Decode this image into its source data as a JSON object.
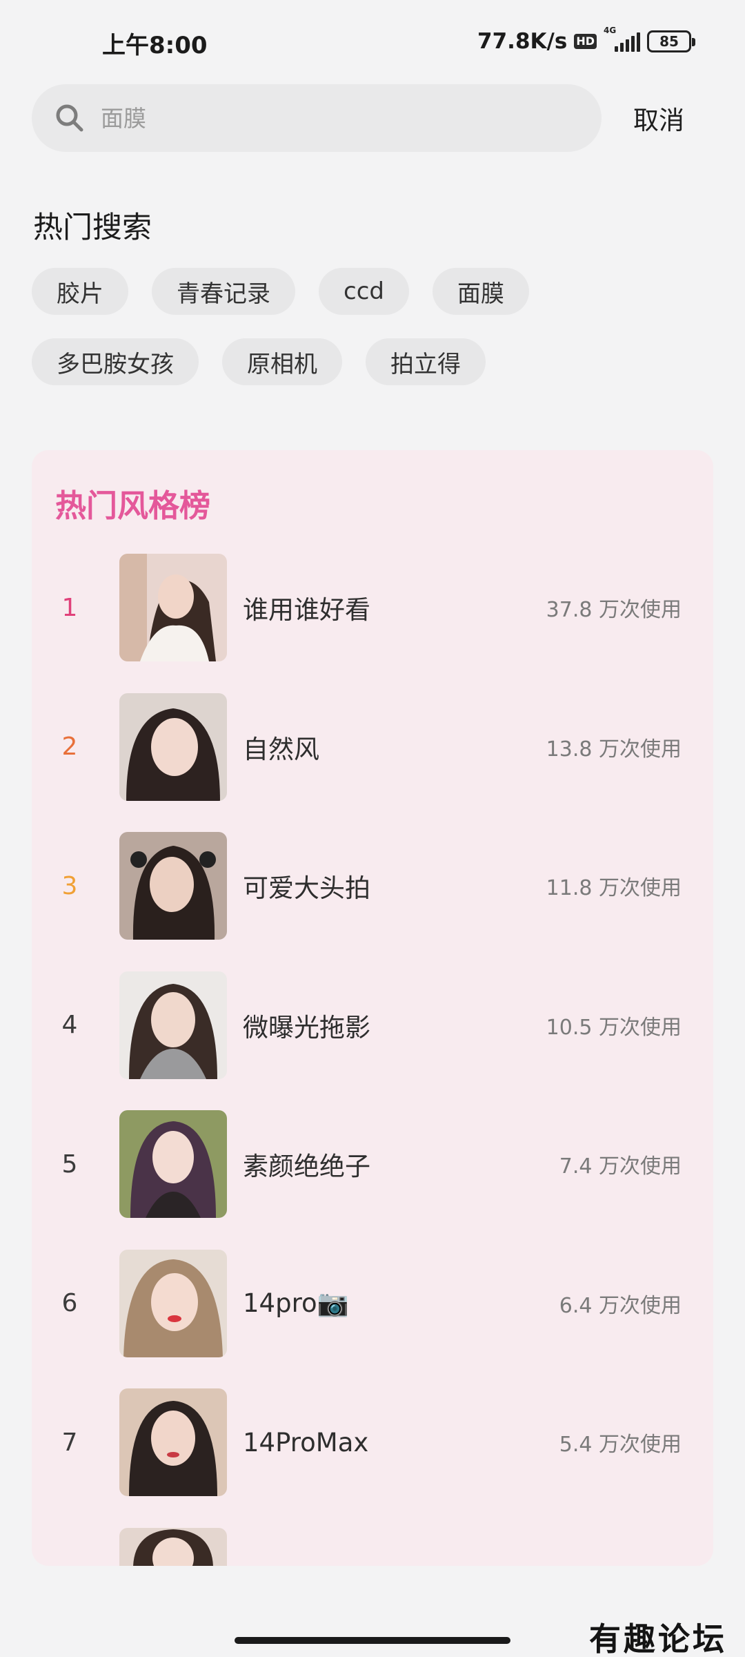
{
  "status_bar": {
    "time": "上午8:00",
    "net_speed": "77.8K/s",
    "hd": "HD",
    "network": "4G",
    "battery": "85"
  },
  "search": {
    "placeholder": "面膜",
    "icon": "search-icon",
    "cancel_label": "取消"
  },
  "hot_search": {
    "title": "热门搜索",
    "chips": [
      "胶片",
      "青春记录",
      "ccd",
      "面膜",
      "多巴胺女孩",
      "原相机",
      "拍立得"
    ]
  },
  "ranking": {
    "title": "热门风格榜",
    "title_color": "#e4589a",
    "items": [
      {
        "rank": "1",
        "name": "谁用谁好看",
        "usage": "37.8 万次使用",
        "rank_color": "#e0417a"
      },
      {
        "rank": "2",
        "name": "自然风",
        "usage": "13.8 万次使用",
        "rank_color": "#e8703a"
      },
      {
        "rank": "3",
        "name": "可爱大头拍",
        "usage": "11.8 万次使用",
        "rank_color": "#f0a035"
      },
      {
        "rank": "4",
        "name": "微曝光拖影",
        "usage": "10.5 万次使用",
        "rank_color": "#3b3b3b"
      },
      {
        "rank": "5",
        "name": "素颜绝绝子",
        "usage": "7.4 万次使用",
        "rank_color": "#3b3b3b"
      },
      {
        "rank": "6",
        "name": "14pro📷",
        "usage": "6.4 万次使用",
        "rank_color": "#3b3b3b"
      },
      {
        "rank": "7",
        "name": "14ProMax",
        "usage": "5.4 万次使用",
        "rank_color": "#3b3b3b"
      }
    ]
  },
  "watermark": "有趣论坛"
}
